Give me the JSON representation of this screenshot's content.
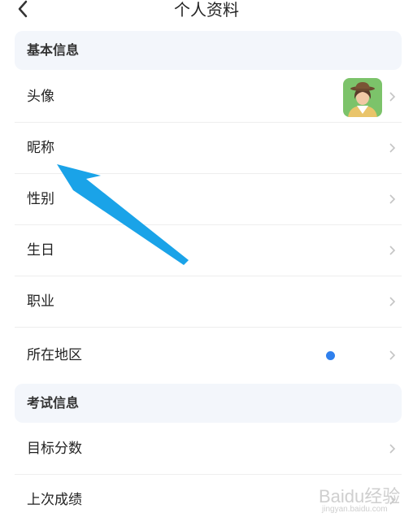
{
  "header": {
    "title": "个人资料",
    "back_icon": "chevron-left-icon"
  },
  "sections": {
    "basic": {
      "title": "基本信息"
    },
    "exam": {
      "title": "考试信息"
    }
  },
  "rows": {
    "avatar": {
      "label": "头像"
    },
    "nickname": {
      "label": "昵称",
      "value": ""
    },
    "gender": {
      "label": "性别",
      "value": ""
    },
    "birthday": {
      "label": "生日",
      "value": ""
    },
    "occupation": {
      "label": "职业",
      "value": ""
    },
    "region": {
      "label": "所在地区",
      "value": ""
    },
    "target_score": {
      "label": "目标分数",
      "value": ""
    },
    "last_score": {
      "label": "上次成绩",
      "value": ""
    }
  },
  "annotation": {
    "color": "#1aa3e8"
  },
  "watermark": {
    "main": "Baidu经验",
    "sub": "jingyan.baidu.com"
  },
  "colors": {
    "section_bg": "#f3f6fb",
    "divider": "#eeeeee",
    "chevron": "#c4c4c4"
  }
}
